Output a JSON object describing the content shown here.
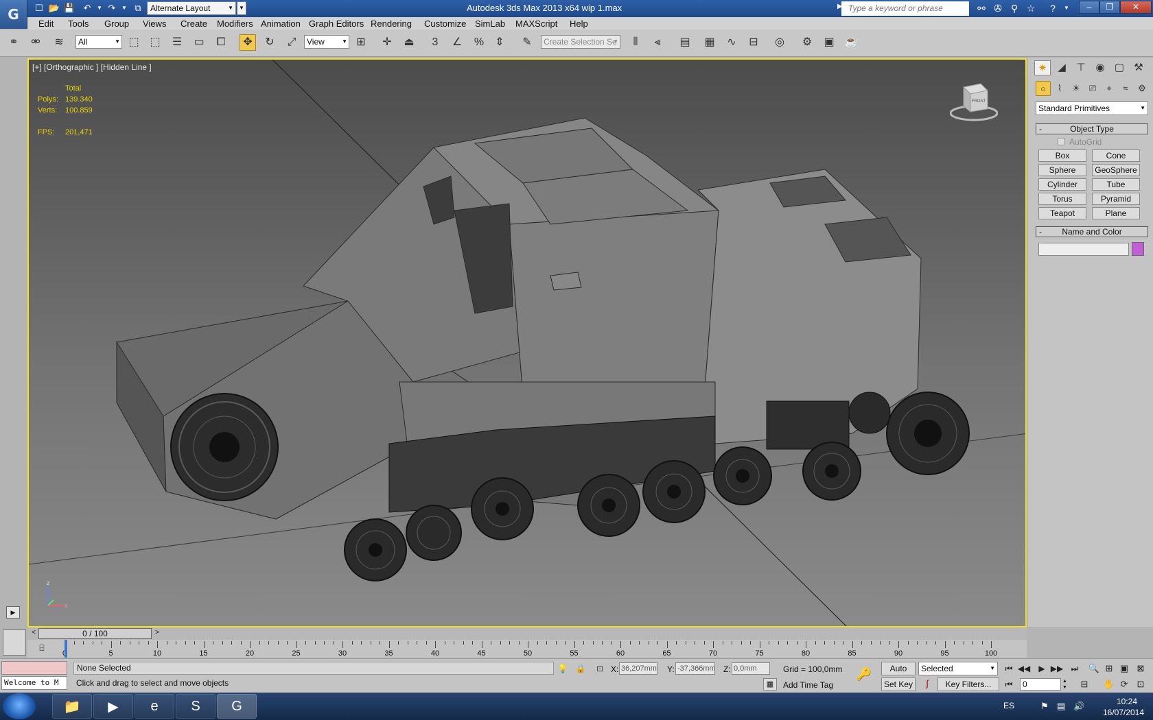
{
  "titlebar": {
    "workspace": "Alternate Layout",
    "title": "Autodesk 3ds Max  2013 x64      wip 1.max",
    "search_placeholder": "Type a keyword or phrase"
  },
  "menu": [
    "Edit",
    "Tools",
    "Group",
    "Views",
    "Create",
    "Modifiers",
    "Animation",
    "Graph Editors",
    "Rendering",
    "Customize",
    "SimLab",
    "MAXScript",
    "Help"
  ],
  "toolbar": {
    "selection_filter": "All",
    "ref_coord": "View",
    "snap_label": "3",
    "selection_set_placeholder": "Create Selection Se"
  },
  "viewport": {
    "label": "[+] [Orthographic ] [Hidden Line ]",
    "stats": {
      "total_label": "Total",
      "polys_label": "Polys:",
      "polys_value": "139.340",
      "verts_label": "Verts:",
      "verts_value": "100.859",
      "fps_label": "FPS:",
      "fps_value": "201,471"
    },
    "viewcube_label": "FRONT",
    "axis": {
      "z": "z",
      "x": "x"
    }
  },
  "command_panel": {
    "category": "Standard Primitives",
    "object_type_title": "Object Type",
    "autogrid": "AutoGrid",
    "primitives": [
      "Box",
      "Cone",
      "Sphere",
      "GeoSphere",
      "Cylinder",
      "Tube",
      "Torus",
      "Pyramid",
      "Teapot",
      "Plane"
    ],
    "name_color_title": "Name and Color",
    "object_color": "#c05fd6"
  },
  "timeline": {
    "slider_label": "0 / 100",
    "ticks": [
      "0",
      "5",
      "10",
      "15",
      "20",
      "25",
      "30",
      "35",
      "40",
      "45",
      "50",
      "55",
      "60",
      "65",
      "70",
      "75",
      "80",
      "85",
      "90",
      "95",
      "100"
    ]
  },
  "status": {
    "listener_text": "Welcome to M",
    "selection": "None Selected",
    "prompt": "Click and drag to select and move objects",
    "x_label": "X:",
    "x_value": "36,207mm",
    "y_label": "Y:",
    "y_value": "-37,366mm",
    "z_label": "Z:",
    "z_value": "0,0mm",
    "grid": "Grid = 100,0mm",
    "add_time_tag": "Add Time Tag",
    "auto_key": "Auto Key",
    "set_key": "Set Key",
    "key_mode": "Selected",
    "key_filters": "Key Filters...",
    "current_frame": "0"
  },
  "taskbar": {
    "language": "ES",
    "time": "10:24",
    "date": "16/07/2014"
  }
}
